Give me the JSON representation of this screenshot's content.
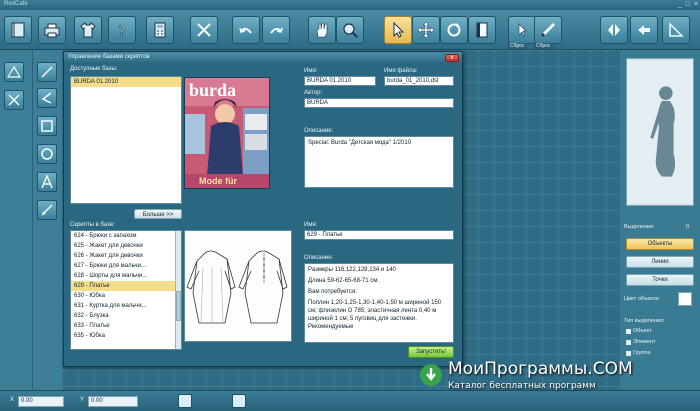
{
  "app": {
    "title": "RedCafe"
  },
  "toolbar": {
    "items": [
      {
        "name": "notebook-icon"
      },
      {
        "name": "printer-icon"
      },
      {
        "name": "shirt-icon"
      },
      {
        "name": "help-icon"
      },
      {
        "name": "calculator-icon"
      },
      {
        "name": "scissors-icon"
      },
      {
        "name": "undo-icon"
      },
      {
        "name": "redo-icon"
      },
      {
        "name": "hand-icon"
      },
      {
        "name": "magnifier-icon"
      },
      {
        "name": "pointer-icon"
      },
      {
        "name": "move-icon"
      },
      {
        "name": "rotate-icon"
      },
      {
        "name": "page-icon"
      },
      {
        "name": "pencil-icon"
      },
      {
        "name": "mirror-vertical-icon"
      },
      {
        "name": "mirror-horizontal-icon"
      },
      {
        "name": "measure-icon"
      }
    ],
    "reset_label_1": "Сброс",
    "reset_label_2": "Сброс"
  },
  "dialog": {
    "title": "Управление базами скриптов",
    "close_label": "x",
    "available_bases_label": "Доступные базы:",
    "bases": [
      "BURDA 01.2010"
    ],
    "more_button": "Больше >>",
    "name_label": "Имя:",
    "name_value": "BURDA 01.2010",
    "filename_label": "Имя файла:",
    "filename_value": "burda_01_2010.dsl",
    "author_label": "Автор:",
    "author_value": "BURDA",
    "description_label": "Описание:",
    "description_value": "Special: Burda \"Детская мода\" 1/2010",
    "cover_brand": "burda",
    "cover_text": "Mode für",
    "scripts_label": "Скрипты в базе:",
    "scripts": [
      "624 - Брюки с запахом",
      "625 - Жакет для девочки",
      "626 - Жакет для девочки",
      "627 - Брюки для мальчи...",
      "628 - Шорты для мальчи...",
      "629 - Платье",
      "630 - Юбка",
      "631 - Куртка для мальчи...",
      "632 - Блузка",
      "633 - Платье",
      "635 - Юбка"
    ],
    "script_name_label": "Имя:",
    "script_name_value": "629 - Платье",
    "script_description_label": "Описание:",
    "script_description": [
      "Размеры 116,122,128,134 и 140",
      "Длина 59-62-65-68-71 см.",
      "Вам потребуется:",
      "Поплин 1,20-1,25-1,30-1,40-1,50 м шириной 150 см; флизелин G 785; эластичная лента 0,40 м шириной 1 см; 5 пуговиц для застежки. Рекомендуемые"
    ],
    "run_button": "Запустить!"
  },
  "right_panel": {
    "selection_label": "Выделение:",
    "selection_count": "0",
    "objects_button": "Объекты",
    "lines_button": "Линии",
    "points_button": "Точки",
    "object_color_label": "Цвет объекта:",
    "selection_type_label": "Тип выделения:",
    "selection_types": [
      "Объект",
      "Элемент",
      "Группа"
    ]
  },
  "statusbar": {
    "x_label": "X",
    "x_value": "0.00",
    "y_label": "Y",
    "y_value": "0.00"
  },
  "watermark": {
    "title": "МоиПрограммы.COM",
    "subtitle": "Каталог бесплатных программ"
  }
}
